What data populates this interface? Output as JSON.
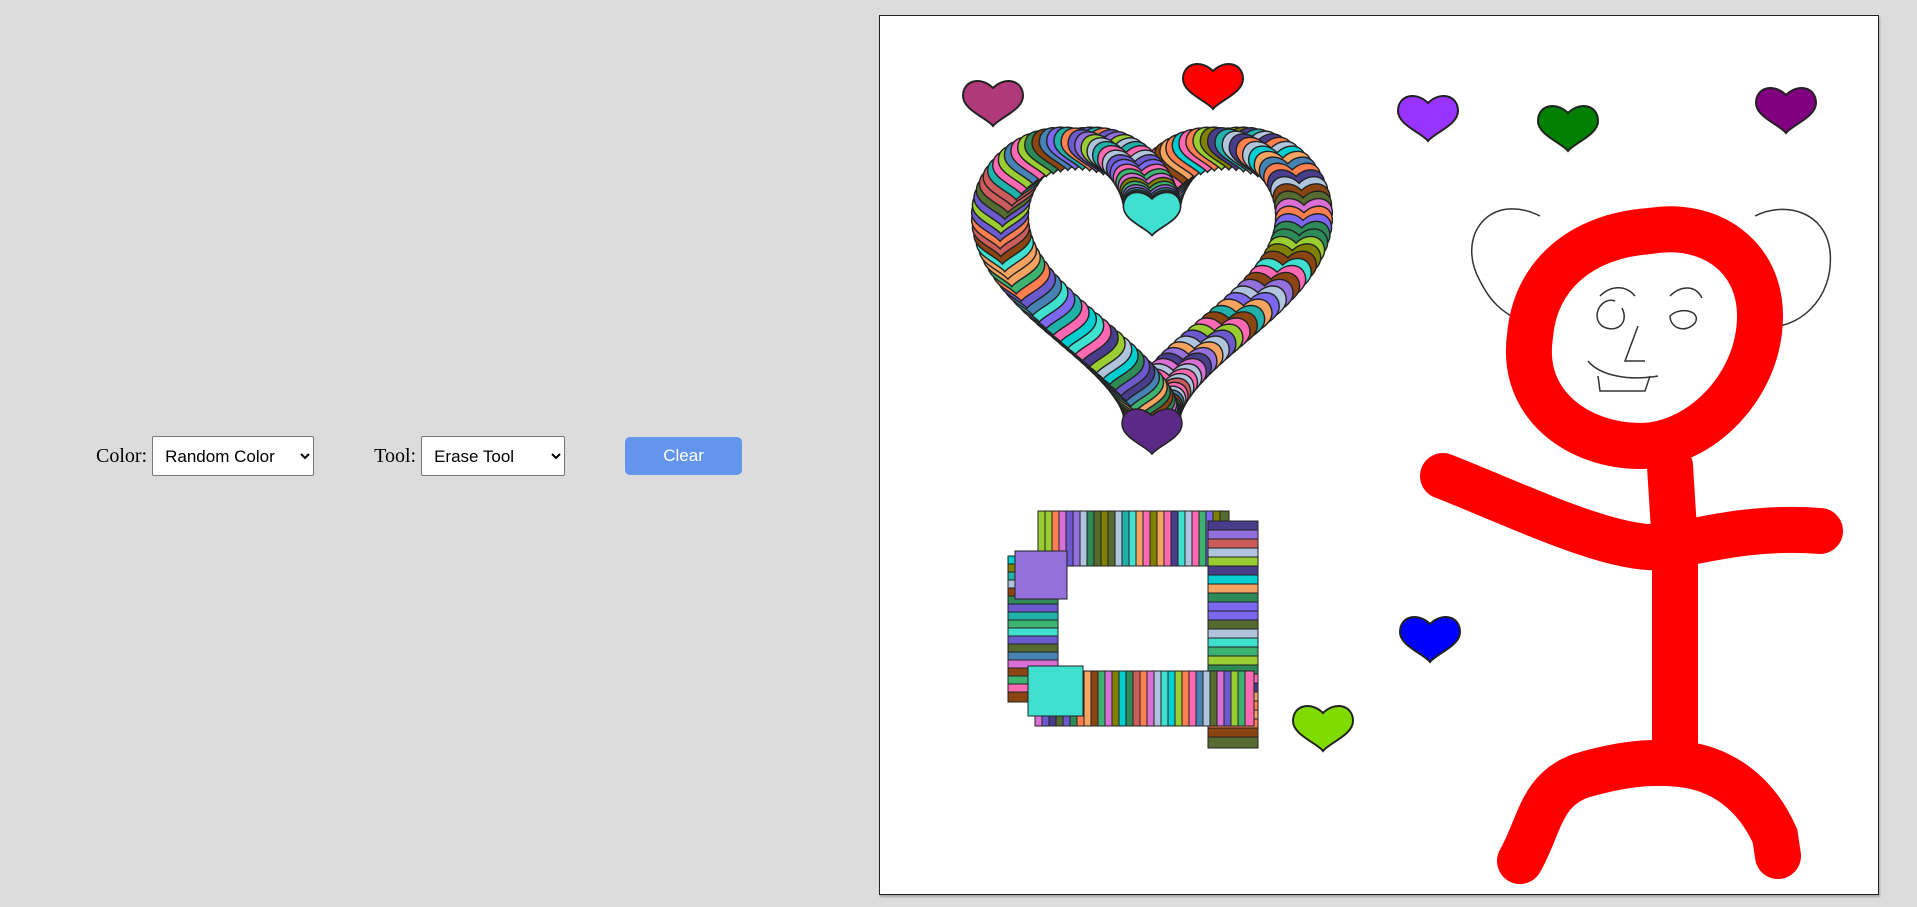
{
  "controls": {
    "color_label": "Color:",
    "color_selected": "Random Color",
    "tool_label": "Tool:",
    "tool_selected": "Erase Tool",
    "clear_label": "Clear"
  },
  "colors": {
    "background": "#dcdcdc",
    "button": "#6495ed",
    "stickman": "#ff0000"
  },
  "canvas": {
    "hearts": [
      {
        "name": "heart-magenta",
        "color": "#b0397a"
      },
      {
        "name": "heart-red",
        "color": "#ff0000"
      },
      {
        "name": "heart-purple",
        "color": "#9933ff"
      },
      {
        "name": "heart-green",
        "color": "#008000"
      },
      {
        "name": "heart-dark-purple",
        "color": "#800080"
      },
      {
        "name": "heart-blue",
        "color": "#0000ff"
      },
      {
        "name": "heart-lime",
        "color": "#7fdb00"
      }
    ]
  }
}
